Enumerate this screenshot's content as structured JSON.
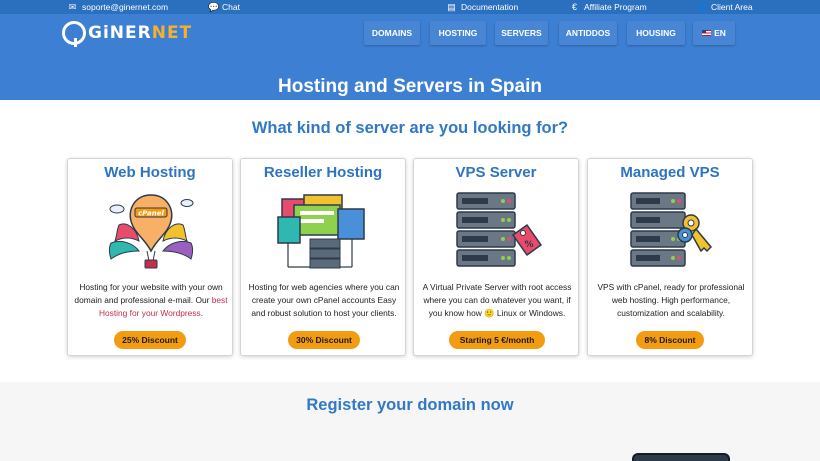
{
  "topbar": {
    "email": "soporte@ginernet.com",
    "chat": "Chat",
    "documentation": "Documentation",
    "affiliate": "Affiliate Program",
    "client_area": "Client Area"
  },
  "logo": {
    "part1": "GiNER",
    "part2": "NET"
  },
  "nav": {
    "domains": "DOMAINS",
    "hosting": "HOSTING",
    "servers": "SERVERS",
    "antiddos": "ANTIDDOS",
    "housing": "HOUSING",
    "language": "EN"
  },
  "hero": {
    "title": "Hosting and Servers in Spain"
  },
  "main": {
    "question": "What kind of server are you looking for?",
    "cards": [
      {
        "title": "Web Hosting",
        "desc": "Hosting for your website with your own domain and professional e-mail. Our ",
        "link": "best Hosting for your Wordpress",
        "desc_end": ".",
        "illus_label": "cPanel",
        "button": "25% Discount"
      },
      {
        "title": "Reseller Hosting",
        "desc": "Hosting for web agencies where you can create your own cPanel accounts Easy and robust solution to host your clients.",
        "button": "30% Discount"
      },
      {
        "title": "VPS Server",
        "desc": "A Virtual Private Server with root access where you can do whatever you want, if you know how 🙂 Linux or Windows.",
        "button": "Starting 5 €/month"
      },
      {
        "title": "Managed VPS",
        "desc": "VPS with cPanel, ready for professional web hosting. High performance, customization and scalability.",
        "button": "8% Discount"
      }
    ]
  },
  "register": {
    "title": "Register your domain now"
  },
  "colors": {
    "topbar": "#2b6fbf",
    "header": "#3d7fd3",
    "accent_blue": "#3178c6",
    "button_orange": "#f39c12",
    "link_red": "#c0304a"
  },
  "icons": [
    "email-icon",
    "chat-icon",
    "document-icon",
    "euro-icon",
    "user-icon",
    "us-flag-icon"
  ]
}
